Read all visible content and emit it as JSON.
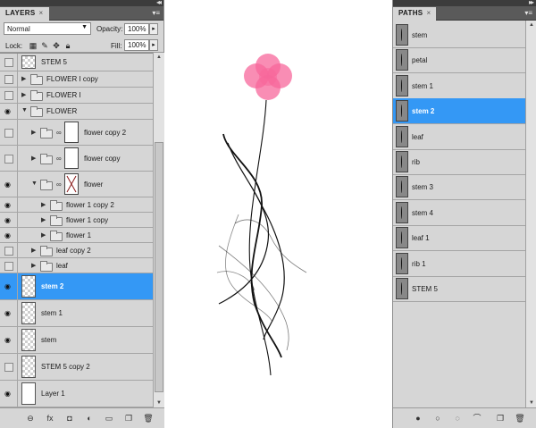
{
  "layers_panel": {
    "tab_label": "LAYERS",
    "tab_close": "×",
    "menu_icon": "panel-menu-icon",
    "blend_mode": "Normal",
    "opacity_label": "Opacity:",
    "opacity_value": "100%",
    "lock_label": "Lock:",
    "fill_label": "Fill:",
    "fill_value": "100%",
    "layers": [
      {
        "name": "STEM 5",
        "kind": "layer",
        "visible": false
      },
      {
        "name": "FLOWER I copy",
        "kind": "group",
        "visible": false
      },
      {
        "name": "FLOWER I",
        "kind": "group",
        "visible": false
      },
      {
        "name": "FLOWER",
        "kind": "group",
        "visible": true
      },
      {
        "name": "flower copy 2",
        "kind": "group-mask",
        "visible": false
      },
      {
        "name": "flower copy",
        "kind": "group-mask",
        "visible": false
      },
      {
        "name": "flower",
        "kind": "group-mask",
        "visible": true
      },
      {
        "name": "flower 1 copy 2",
        "kind": "group",
        "visible": true
      },
      {
        "name": "flower 1 copy",
        "kind": "group",
        "visible": true
      },
      {
        "name": "flower 1",
        "kind": "group",
        "visible": true
      },
      {
        "name": "leaf copy 2",
        "kind": "group",
        "visible": false
      },
      {
        "name": "leaf",
        "kind": "group",
        "visible": false
      },
      {
        "name": "stem 2",
        "kind": "layer",
        "visible": true,
        "selected": true
      },
      {
        "name": "stem 1",
        "kind": "layer",
        "visible": true
      },
      {
        "name": "stem",
        "kind": "layer",
        "visible": true
      },
      {
        "name": "STEM 5 copy 2",
        "kind": "layer",
        "visible": false
      },
      {
        "name": "Layer 1",
        "kind": "layer",
        "visible": true
      }
    ],
    "footer_icons": [
      "link-layers-icon",
      "fx-icon",
      "add-mask-icon",
      "adjustment-icon",
      "new-group-icon",
      "new-layer-icon",
      "trash-icon"
    ]
  },
  "paths_panel": {
    "tab_label": "PATHS",
    "tab_close": "×",
    "menu_icon": "panel-menu-icon",
    "paths": [
      {
        "name": "stem"
      },
      {
        "name": "petal"
      },
      {
        "name": "stem 1"
      },
      {
        "name": "stem 2",
        "selected": true
      },
      {
        "name": "leaf"
      },
      {
        "name": "rib"
      },
      {
        "name": "stem 3"
      },
      {
        "name": "stem 4"
      },
      {
        "name": "leaf 1"
      },
      {
        "name": "rib 1"
      },
      {
        "name": "STEM 5"
      }
    ],
    "footer_icons": [
      "fill-path-icon",
      "stroke-path-icon",
      "load-selection-icon",
      "make-work-path-icon",
      "new-path-icon",
      "trash-icon"
    ]
  },
  "canvas": {
    "petal_color": "#f7679b",
    "stem_color": "#111111"
  }
}
